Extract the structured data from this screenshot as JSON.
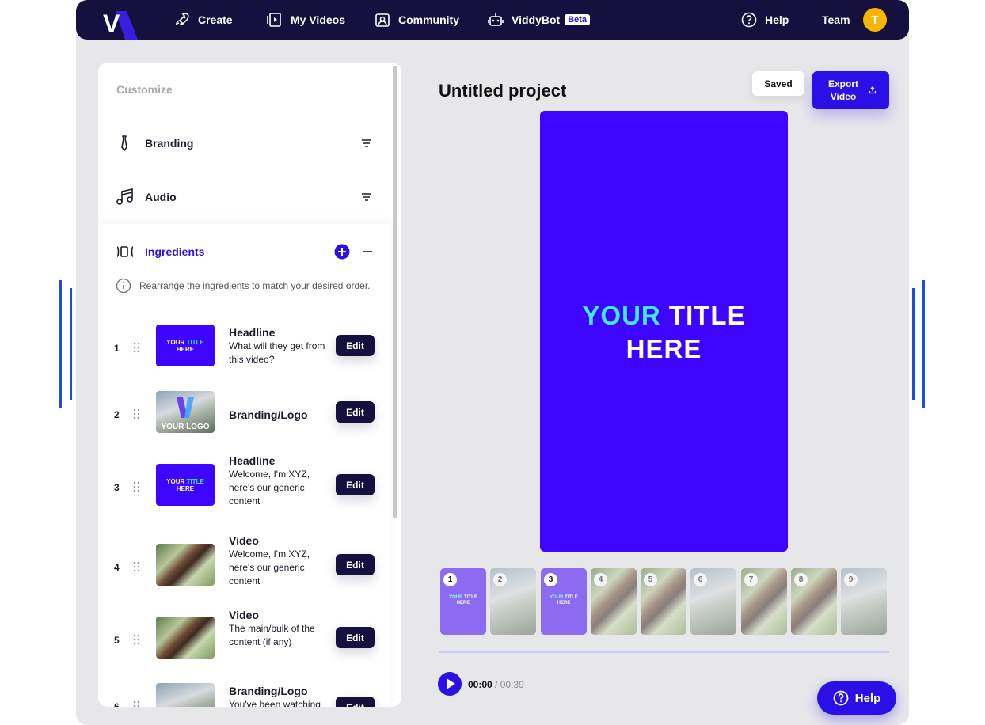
{
  "nav": {
    "logo_letter": "V",
    "items": [
      {
        "label": "Create"
      },
      {
        "label": "My Videos"
      },
      {
        "label": "Community"
      },
      {
        "label": "ViddyBot",
        "badge": "Beta"
      },
      {
        "label": "Help"
      },
      {
        "label": "Team"
      }
    ],
    "avatar_initial": "T"
  },
  "panel": {
    "title": "Customize",
    "sections": [
      {
        "label": "Branding",
        "icon": "tie-icon"
      },
      {
        "label": "Audio",
        "icon": "music-note-icon"
      },
      {
        "label": "Ingredients",
        "icon": "ingredients-icon"
      }
    ],
    "hint": "Rearrange the ingredients to match your desired order.",
    "edit_label": "Edit",
    "thumb_title_a": "YOUR",
    "thumb_title_b": "TITLE",
    "thumb_title_c": "HERE",
    "ingredients": [
      {
        "num": "1",
        "name": "Headline",
        "desc": "What will they get from this video?",
        "thumb": "title"
      },
      {
        "num": "2",
        "name": "Branding/Logo",
        "desc": "",
        "thumb": "brand",
        "thumb_text": "YOUR LOGO"
      },
      {
        "num": "3",
        "name": "Headline",
        "desc": "Welcome, I'm XYZ, here's our generic content",
        "thumb": "title"
      },
      {
        "num": "4",
        "name": "Video",
        "desc": "Welcome, I'm XYZ, here's our generic content",
        "thumb": "photo"
      },
      {
        "num": "5",
        "name": "Video",
        "desc": "The main/bulk of the content (if any)",
        "thumb": "photo"
      },
      {
        "num": "6",
        "name": "Branding/Logo",
        "desc": "You've been watching",
        "thumb": "brand"
      }
    ]
  },
  "project": {
    "title": "Untitled project",
    "saved_label": "Saved",
    "export_label": "Export Video",
    "preview_title_a": "YOUR",
    "preview_title_b": "TITLE",
    "preview_title_c": "HERE",
    "frames": [
      "1",
      "2",
      "3",
      "4",
      "5",
      "6",
      "7",
      "8",
      "9"
    ],
    "frame_logo_text": "YOUR LOGO",
    "time_current": "00:00",
    "time_total": "/ 00:39",
    "help_fab_label": "Help"
  },
  "colors": {
    "accent": "#2a10e6",
    "preview_bg": "#3d05ff",
    "nav_bg": "#15103d",
    "title_cyan": "#41e6ff",
    "avatar": "#f7b500"
  }
}
